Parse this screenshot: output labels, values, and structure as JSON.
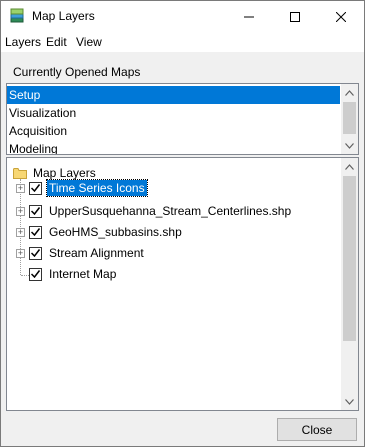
{
  "window": {
    "title": "Map Layers"
  },
  "menu": {
    "items": [
      "Layers",
      "Edit",
      "View"
    ]
  },
  "maps_section": {
    "label": "Currently Opened Maps",
    "items": [
      "Setup",
      "Visualization",
      "Acquisition",
      "Modeling"
    ],
    "selected": "Setup"
  },
  "layers_tree": {
    "root": "Map Layers",
    "items": [
      {
        "label": "Time Series Icons",
        "checked": true,
        "expandable": true,
        "selected": true
      },
      {
        "label": "UpperSusquehanna_Stream_Centerlines.shp",
        "checked": true,
        "expandable": true
      },
      {
        "label": "GeoHMS_subbasins.shp",
        "checked": true,
        "expandable": true
      },
      {
        "label": "Stream Alignment",
        "checked": true,
        "expandable": true
      },
      {
        "label": "Internet Map",
        "checked": true,
        "expandable": false
      }
    ]
  },
  "buttons": {
    "close": "Close"
  },
  "colors": {
    "selection": "#0078d7",
    "window_bg": "#f0f0f0"
  }
}
